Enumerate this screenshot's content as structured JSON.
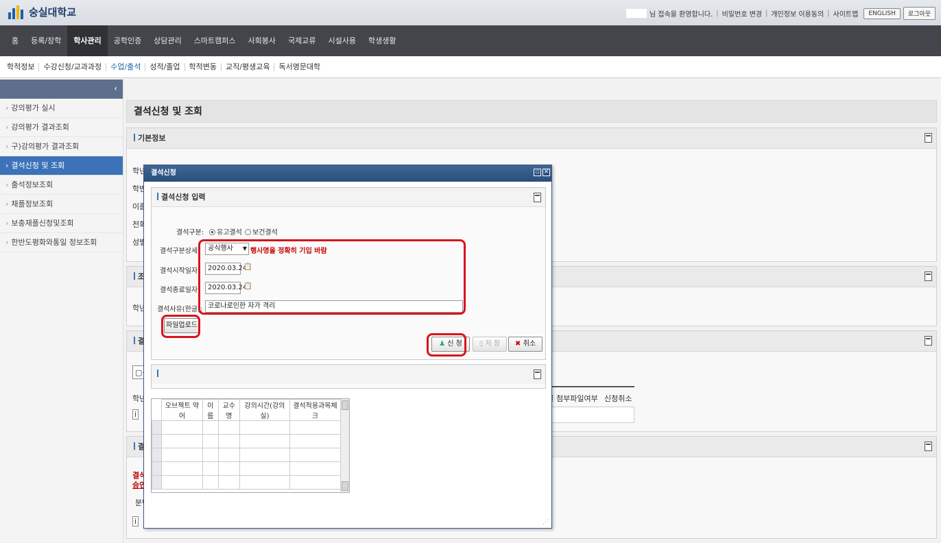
{
  "header": {
    "logo_text": "숭실대학교",
    "welcome": "님 접속을 환영합니다.",
    "links": [
      "비밀번호 변경",
      "개인정보 이용동의",
      "사이트맵"
    ],
    "english_button": "ENGLISH",
    "logout_button": "로그아웃"
  },
  "main_nav": [
    "홈",
    "등록/장학",
    "학사관리",
    "공학인증",
    "상담관리",
    "스마트캠퍼스",
    "사회봉사",
    "국제교류",
    "시설사용",
    "학생생활"
  ],
  "main_nav_active": "학사관리",
  "sub_nav": [
    "학적정보",
    "수강신청/교과과정",
    "수업/출석",
    "성적/졸업",
    "학적변동",
    "교직/평생교육",
    "독서명문대학"
  ],
  "sub_nav_active": "수업/출석",
  "sidebar": {
    "collapse_glyph": "‹",
    "items": [
      "강의평가 실시",
      "강의평가 결과조회",
      "구)강의평가 결과조회",
      "결석신청 및 조회",
      "출석정보조회",
      "채플정보조회",
      "보충재플신청및조회",
      "한반도평화와통일 정보조회"
    ],
    "active": "결석신청 및 조회"
  },
  "page": {
    "title": "결석신청 및 조회",
    "basic_info": {
      "title": "기본정보",
      "labels": [
        "학년:",
        "학번:",
        "이름:",
        "전화:",
        "성별:"
      ]
    },
    "panel2": {
      "title": "조회",
      "label": "학년도"
    },
    "panel3": {
      "title": "결석",
      "doc_button": "신",
      "row_label": "학년",
      "info_prefix": "i",
      "columns_tail": [
        "일",
        "첨부파일여부",
        "신청취소"
      ]
    },
    "panel4": {
      "title": "결석",
      "red_line1": "결석적",
      "red_line2": "승인 원",
      "sub_label": "분반",
      "info_prefix": "i"
    }
  },
  "modal": {
    "title": "결석신청",
    "panel_title": "결석신청 입력",
    "absence_type_label": "결석구분:",
    "absence_type_options": [
      "유고결석",
      "보건결석"
    ],
    "absence_type_selected": "유고결석",
    "detail_label": "결석구분상세:",
    "detail_value": "공식행사",
    "detail_warning": "행사명을 정확히 기입 바람",
    "start_label": "결석시작일자:",
    "start_value": "2020.03.24",
    "end_label": "결석종료일자:",
    "end_value": "2020.03.24",
    "reason_label": "결석사유(한글):",
    "reason_value": "코로나로인한 자가 격리",
    "upload_button": "파일업로드",
    "apply_button": "신 청",
    "save_button": "저 장",
    "cancel_button": "취소",
    "grid_columns": [
      "오브젝트 약어",
      "이름",
      "교수명",
      "강의시간(강의실)",
      "결석적용과목체크"
    ]
  },
  "colors": {
    "nav_bg": "#43454a",
    "sidebar_active": "#3c73b8",
    "highlight_red": "#d9141b",
    "modal_title": "#2a4f7c"
  }
}
